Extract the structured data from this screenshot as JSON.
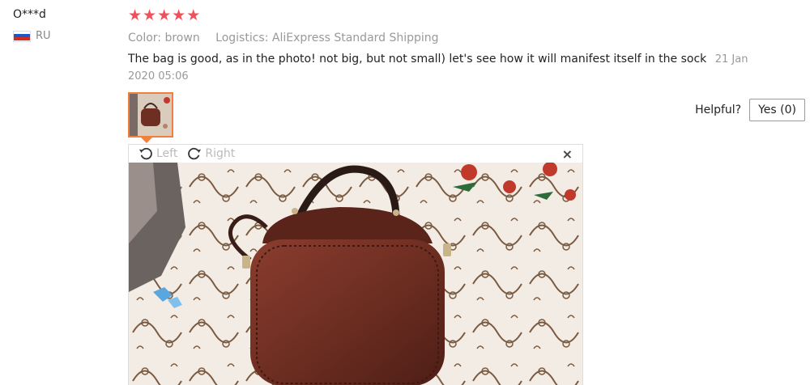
{
  "user": {
    "name": "O***d",
    "country": "RU"
  },
  "rating": {
    "stars": 5,
    "max": 5
  },
  "meta": {
    "color": "Color: brown",
    "logistics": "Logistics: AliExpress Standard Shipping"
  },
  "review": {
    "text": "The bag is good, as in the photo! not big, but not small) let's see how it will manifest itself in the sock",
    "date": "21 Jan 2020 05:06"
  },
  "helpful": {
    "label": "Helpful?",
    "yes_button": "Yes (0)"
  },
  "viewer": {
    "rotate_left": "Left",
    "rotate_right": "Right",
    "close": "×"
  },
  "colors": {
    "star": "#f0505a",
    "thumb_border": "#f0803c",
    "bag": "#6e2e22"
  }
}
